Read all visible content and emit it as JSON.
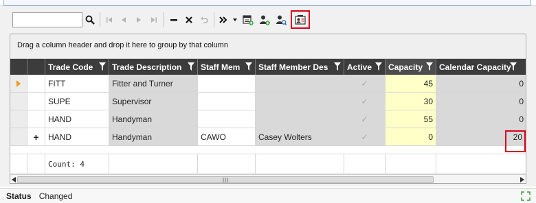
{
  "toolbar": {
    "search_value": "",
    "icons": [
      "search-icon",
      "first-record-icon",
      "previous-record-icon",
      "next-record-icon",
      "last-record-icon",
      "minus-icon",
      "close-icon",
      "undo-icon",
      "more-icon",
      "dropdown-icon",
      "add-record-icon",
      "add-user-icon",
      "find-user-icon",
      "contact-card-icon"
    ]
  },
  "grid": {
    "group_hint": "Drag a column header and drop it here to group by that column",
    "columns": [
      "Trade Code",
      "Trade Description",
      "Staff Mem",
      "Staff Member Des",
      "Active",
      "Capacity",
      "Calendar Capacity"
    ],
    "rows": [
      {
        "trade_code": "FITT",
        "trade_description": "Fitter and Turner",
        "staff_member": "",
        "staff_member_description": "",
        "capacity": "45",
        "calendar_capacity": "0"
      },
      {
        "trade_code": "SUPE",
        "trade_description": "Supervisor",
        "staff_member": "",
        "staff_member_description": "",
        "capacity": "30",
        "calendar_capacity": "0"
      },
      {
        "trade_code": "HAND",
        "trade_description": "Handyman",
        "staff_member": "",
        "staff_member_description": "",
        "capacity": "55",
        "calendar_capacity": "0"
      },
      {
        "trade_code": "HAND",
        "trade_description": "Handyman",
        "staff_member": "CAWO",
        "staff_member_description": "Casey Wolters",
        "capacity": "0",
        "calendar_capacity": "20"
      }
    ],
    "count_label": "Count: 4",
    "new_row_marker": "+"
  },
  "status": {
    "label": "Status",
    "value": "Changed"
  },
  "colors": {
    "header_bg": "#3c3c3c",
    "capacity_bg": "#ffffc8",
    "readonly_bg": "#d9d9d9",
    "highlight": "#d9001b",
    "row_indicator": "#f09a1c"
  }
}
